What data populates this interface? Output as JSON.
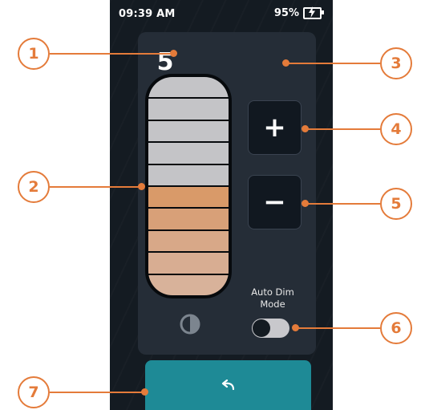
{
  "status_bar": {
    "time": "09:39 AM",
    "battery": "95%"
  },
  "brightness": {
    "level": "5",
    "segments_total": 10,
    "segments_on": 4
  },
  "buttons": {
    "increase": "+",
    "decrease": "−"
  },
  "auto_dim": {
    "label_line1": "Auto Dim",
    "label_line2": "Mode",
    "enabled": false
  },
  "callouts": [
    "1",
    "2",
    "3",
    "4",
    "5",
    "6",
    "7"
  ],
  "colors": {
    "accent": "#e47b3a",
    "back_button": "#1e8a96",
    "level_fill": "#d99a69"
  },
  "icons": {
    "contrast_top": "contrast-icon",
    "contrast_bottom": "contrast-icon",
    "back": "undo-arrow-icon",
    "battery": "battery-charging-icon"
  }
}
